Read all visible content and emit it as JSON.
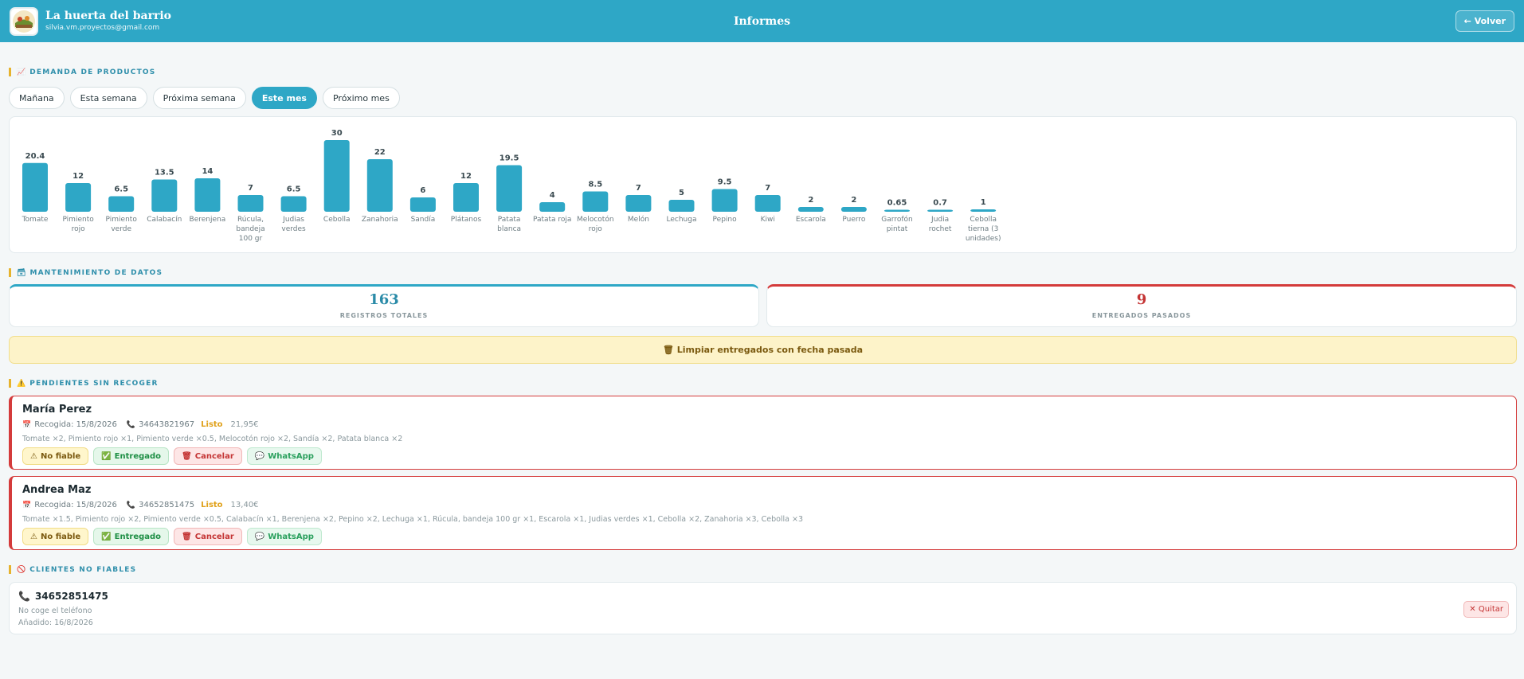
{
  "header": {
    "app_name": "La huerta del barrio",
    "email": "silvia.vm.proyectos@gmail.com",
    "title": "Informes",
    "back_label": "← Volver"
  },
  "demand": {
    "section_title": "DEMANDA DE PRODUCTOS",
    "section_icon": "📈",
    "tabs": [
      "Mañana",
      "Esta semana",
      "Próxima semana",
      "Este mes",
      "Próximo mes"
    ],
    "active_tab": "Este mes"
  },
  "chart_data": {
    "type": "bar",
    "title": "",
    "xlabel": "",
    "ylabel": "",
    "ylim": [
      0,
      30
    ],
    "grid": false,
    "bar_color": "#2ea7c6",
    "categories": [
      "Tomate",
      "Pimiento rojo",
      "Pimiento verde",
      "Calabacín",
      "Berenjena",
      "Rúcula, bandeja 100 gr",
      "Judias verdes",
      "Cebolla",
      "Zanahoria",
      "Sandía",
      "Plátanos",
      "Patata blanca",
      "Patata roja",
      "Melocotón rojo",
      "Melón",
      "Lechuga",
      "Pepino",
      "Kiwi",
      "Escarola",
      "Puerro",
      "Garrofón pintat",
      "Judia rochet",
      "Cebolla tierna (3 unidades)"
    ],
    "category_lines": [
      [
        "Tomate"
      ],
      [
        "Pimiento",
        "rojo"
      ],
      [
        "Pimiento",
        "verde"
      ],
      [
        "Calabacín"
      ],
      [
        "Berenjena"
      ],
      [
        "Rúcula,",
        "bandeja",
        "100 gr"
      ],
      [
        "Judias",
        "verdes"
      ],
      [
        "Cebolla"
      ],
      [
        "Zanahoria"
      ],
      [
        "Sandía"
      ],
      [
        "Plátanos"
      ],
      [
        "Patata",
        "blanca"
      ],
      [
        "Patata roja"
      ],
      [
        "Melocotón",
        "rojo"
      ],
      [
        "Melón"
      ],
      [
        "Lechuga"
      ],
      [
        "Pepino"
      ],
      [
        "Kiwi"
      ],
      [
        "Escarola"
      ],
      [
        "Puerro"
      ],
      [
        "Garrofón",
        "pintat"
      ],
      [
        "Judia",
        "rochet"
      ],
      [
        "Cebolla",
        "tierna (3",
        "unidades)"
      ]
    ],
    "value_labels": [
      "20.4",
      "12",
      "6.5",
      "13.5",
      "14",
      "7",
      "6.5",
      "30",
      "22",
      "6",
      "12",
      "19.5",
      "4",
      "8.5",
      "7",
      "5",
      "9.5",
      "7",
      "2",
      "2",
      "0.65",
      "0.7",
      "1"
    ],
    "values": [
      20.4,
      12,
      6.5,
      13.5,
      14,
      7,
      6.5,
      30,
      22,
      6,
      12,
      19.5,
      4,
      8.5,
      7,
      5,
      9.5,
      7,
      2,
      2,
      0.65,
      0.7,
      1
    ]
  },
  "maintenance": {
    "section_title": "MANTENIMIENTO DE DATOS",
    "section_icon": "🗃",
    "total_value": "163",
    "total_label": "REGISTROS TOTALES",
    "past_value": "9",
    "past_label": "ENTREGADOS PASADOS",
    "clean_label": "🗑 Limpiar entregados con fecha pasada"
  },
  "pending": {
    "section_title": "PENDIENTES SIN RECOGER",
    "section_icon": "⚠️",
    "orders": [
      {
        "name": "María Perez",
        "pickup": "Recogida: 15/8/2026",
        "phone": "34643821967",
        "status": "Listo",
        "price": "21,95€",
        "items": "Tomate ×2, Pimiento rojo ×1, Pimiento verde ×0.5, Melocotón rojo ×2, Sandía ×2, Patata blanca ×2"
      },
      {
        "name": "Andrea Maz",
        "pickup": "Recogida: 15/8/2026",
        "phone": "34652851475",
        "status": "Listo",
        "price": "13,40€",
        "items": "Tomate ×1.5, Pimiento rojo ×2, Pimiento verde ×0.5, Calabacín ×1, Berenjena ×2, Pepino ×2, Lechuga ×1, Rúcula, bandeja 100 gr ×1, Escarola ×1, Judias verdes ×1, Cebolla ×2, Zanahoria ×3, Cebolla ×3"
      }
    ],
    "actions": {
      "unreliable": "No fiable",
      "delivered": "Entregado",
      "cancel": "Cancelar",
      "whatsapp": "WhatsApp"
    }
  },
  "unreliable_clients": {
    "section_title": "CLIENTES NO FIABLES",
    "section_icon": "🚫",
    "clients": [
      {
        "phone": "34652851475",
        "note": "No coge el teléfono",
        "added": "Añadido: 16/8/2026",
        "remove_label": "✕ Quitar"
      }
    ]
  }
}
